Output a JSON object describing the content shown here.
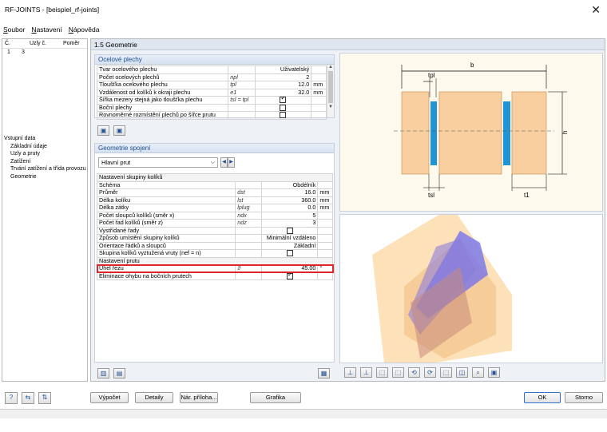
{
  "window": {
    "title": "RF-JOINTS - [beispiel_rf-joints]",
    "close_glyph": "✕"
  },
  "menu": [
    {
      "label": "Soubor",
      "underline": "S",
      "rest": "oubor"
    },
    {
      "label": "Nastavení",
      "underline": "N",
      "rest": "astavení"
    },
    {
      "label": "Nápověda",
      "underline": "N",
      "rest": "ápověda"
    }
  ],
  "left": {
    "headers": [
      "Č.",
      "Uzly č.",
      "Poměr"
    ],
    "rows": [
      {
        "no": "1",
        "nodes": "3",
        "ratio": ""
      }
    ],
    "tree_root": "Vstupní data",
    "tree_items": [
      "Základní údaje",
      "Uzly a pruty",
      "Zatížení",
      "Trvání zatížení a třída provozu",
      "Geometrie"
    ]
  },
  "main": {
    "title": "1.5 Geometrie"
  },
  "plates": {
    "heading": "Ocelové plechy",
    "rows": [
      {
        "label": "Tvar ocelového plechu",
        "sym": "",
        "value": "Uživatelský",
        "unit": "",
        "type": "text"
      },
      {
        "label": "Počet ocelových plechů",
        "sym": "npl",
        "value": "2",
        "unit": "",
        "type": "text"
      },
      {
        "label": "Tloušťka ocelového plechu",
        "sym": "tpl",
        "value": "12.0",
        "unit": "mm",
        "type": "text"
      },
      {
        "label": "Vzdálenost od kolíků k okraji plechu",
        "sym": "e1",
        "value": "32.0",
        "unit": "mm",
        "type": "text"
      },
      {
        "label": "Šířka mezery stejná jako tloušťka plechu",
        "sym": "tsl = tpl",
        "value": "",
        "unit": "",
        "type": "check",
        "checked": true
      },
      {
        "label": "Boční plechy",
        "sym": "",
        "value": "",
        "unit": "",
        "type": "check",
        "checked": false
      },
      {
        "label": "Rovnoměrné rozmístění plechů po šířce prutu",
        "sym": "",
        "value": "",
        "unit": "",
        "type": "check",
        "checked": false
      }
    ]
  },
  "joint": {
    "heading": "Geometrie spojení",
    "selected_member": "Hlavní prut",
    "rows": [
      {
        "label": "Nastavení skupiny kolíků",
        "sym": "",
        "value": "",
        "unit": "",
        "type": "section"
      },
      {
        "label": "Schéma",
        "sym": "",
        "value": "Obdélník",
        "unit": "",
        "type": "text"
      },
      {
        "label": "Průměr",
        "sym": "dst",
        "value": "16.0",
        "unit": "mm",
        "type": "text"
      },
      {
        "label": "Délka kolíku",
        "sym": "lst",
        "value": "360.0",
        "unit": "mm",
        "type": "text"
      },
      {
        "label": "Délka zátky",
        "sym": "lplug",
        "value": "0.0",
        "unit": "mm",
        "type": "text"
      },
      {
        "label": "Počet sloupců kolíků (směr x)",
        "sym": "ndx",
        "value": "5",
        "unit": "",
        "type": "text"
      },
      {
        "label": "Počet řad kolíků (směr z)",
        "sym": "ndz",
        "value": "3",
        "unit": "",
        "type": "text"
      },
      {
        "label": "Vystřídané řady",
        "sym": "",
        "value": "",
        "unit": "",
        "type": "check",
        "checked": false
      },
      {
        "label": "Způsob umístění skupiny kolíků",
        "sym": "",
        "value": "Minimální vzdáleno",
        "unit": "",
        "type": "text"
      },
      {
        "label": "Orientace řádků a sloupců",
        "sym": "",
        "value": "Základní",
        "unit": "",
        "type": "text"
      },
      {
        "label": "Skupina kolíků vyztužená vruty (nef = n)",
        "sym": "",
        "value": "",
        "unit": "",
        "type": "check",
        "checked": false
      },
      {
        "label": "Nastavení prutu",
        "sym": "",
        "value": "",
        "unit": "",
        "type": "section"
      },
      {
        "label": "Úhel řezu",
        "sym": "ϑ",
        "value": "45.00",
        "unit": "°",
        "type": "text",
        "highlight": true
      },
      {
        "label": "Eliminace ohybu na bočních prutech",
        "sym": "",
        "value": "",
        "unit": "",
        "type": "check",
        "checked": true
      }
    ]
  },
  "drawing": {
    "b": "b",
    "tpl": "tpl",
    "tsl": "tsl",
    "t1": "t1",
    "h": "h"
  },
  "buttons": {
    "calc": "Výpočet",
    "details": "Detaily",
    "annex": "Nár. příloha...",
    "graphics": "Grafika",
    "ok": "OK",
    "cancel": "Storno"
  }
}
